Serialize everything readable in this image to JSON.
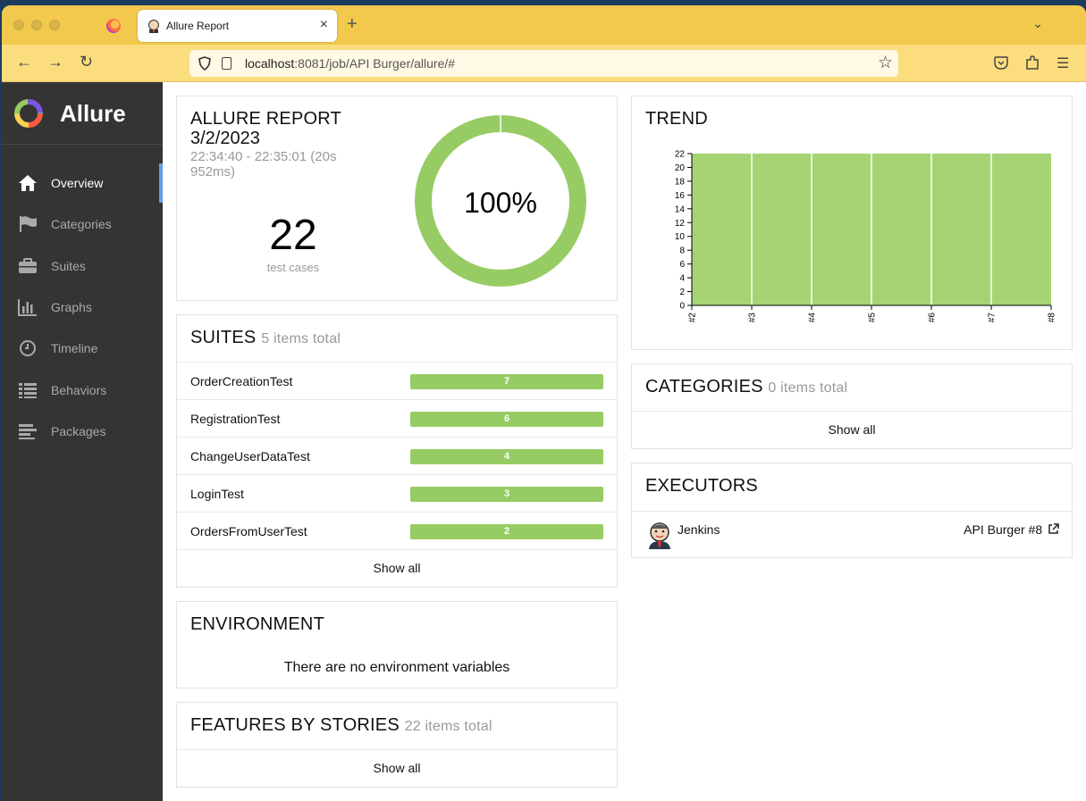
{
  "browser": {
    "tab_title": "Allure Report",
    "tab_close": "×",
    "new_tab": "+",
    "tab_list": "⌄",
    "url_host": "localhost",
    "url_rest": ":8081/job/API Burger/allure/#",
    "back": "←",
    "forward": "→",
    "reload": "↻",
    "bookmark": "☆",
    "pocket_icon": "pocket-icon",
    "extensions_icon": "puzzle-icon",
    "menu_icon": "☰"
  },
  "sidebar": {
    "brand": "Allure",
    "items": [
      {
        "label": "Overview",
        "icon": "home-icon",
        "active": true
      },
      {
        "label": "Categories",
        "icon": "flag-icon"
      },
      {
        "label": "Suites",
        "icon": "briefcase-icon"
      },
      {
        "label": "Graphs",
        "icon": "bar-chart-icon"
      },
      {
        "label": "Timeline",
        "icon": "clock-icon"
      },
      {
        "label": "Behaviors",
        "icon": "list-icon"
      },
      {
        "label": "Packages",
        "icon": "align-left-icon"
      }
    ]
  },
  "summary": {
    "title": "ALLURE REPORT",
    "date": "3/2/2023",
    "time_range": "22:34:40 - 22:35:01 (20s 952ms)",
    "count": "22",
    "count_label": "test cases",
    "percent": "100%",
    "passed_fraction": 1.0,
    "color_passed": "#97cc64"
  },
  "suites": {
    "title": "SUITES",
    "subtitle": "5 items total",
    "rows": [
      {
        "name": "OrderCreationTest",
        "count": "7"
      },
      {
        "name": "RegistrationTest",
        "count": "6"
      },
      {
        "name": "ChangeUserDataTest",
        "count": "4"
      },
      {
        "name": "LoginTest",
        "count": "3"
      },
      {
        "name": "OrdersFromUserTest",
        "count": "2"
      }
    ],
    "show_all": "Show all"
  },
  "environment": {
    "title": "ENVIRONMENT",
    "message": "There are no environment variables"
  },
  "features": {
    "title": "FEATURES BY STORIES",
    "subtitle": "22 items total",
    "show_all": "Show all"
  },
  "trend": {
    "title": "TREND"
  },
  "categories": {
    "title": "CATEGORIES",
    "subtitle": "0 items total",
    "show_all": "Show all"
  },
  "executors": {
    "title": "EXECUTORS",
    "name": "Jenkins",
    "build": "API Burger #8"
  },
  "chart_data": {
    "type": "area",
    "title": "TREND",
    "x": [
      "#2",
      "#3",
      "#4",
      "#5",
      "#6",
      "#7",
      "#8"
    ],
    "series": [
      {
        "values": [
          22,
          22,
          22,
          22,
          22,
          22,
          22
        ],
        "color": "#97cc64"
      }
    ],
    "ylim": [
      0,
      22
    ],
    "yticks": [
      0,
      2,
      4,
      6,
      8,
      10,
      12,
      14,
      16,
      18,
      20,
      22
    ],
    "grid": false
  }
}
